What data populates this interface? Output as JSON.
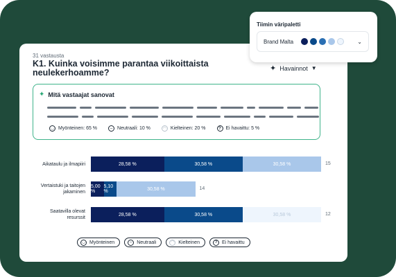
{
  "survey": {
    "response_count": "31 vastausta",
    "question": "K1. Kuinka voisimme parantaa viikoittaista neulekerhoamme?",
    "insights_button": "Havainnot"
  },
  "summary": {
    "title": "Mitä vastaajat sanovat",
    "sentiments": [
      {
        "label": "Myönteinen: 65 %",
        "icon": "smile-icon"
      },
      {
        "label": "Neutraali: 10 %",
        "icon": "neutral-face-icon"
      },
      {
        "label": "Kielteinen: 20 %",
        "icon": "frown-icon"
      },
      {
        "label": "Ei havaittu: 5 %",
        "icon": "question-icon"
      }
    ]
  },
  "chart_data": {
    "type": "bar",
    "orientation": "horizontal",
    "stacked": true,
    "categories": [
      "Aikataulu ja ilmapiiri",
      "Vertaistuki ja taitojen jakaminen",
      "Saatavilla olevat resurssit"
    ],
    "totals": [
      "15",
      "14",
      "12"
    ],
    "series": [
      {
        "name": "Myönteinen",
        "color": "#0b1f5c",
        "values": [
          28.58,
          5.0,
          28.58
        ],
        "labels": [
          "28,58 %",
          "5,00 %",
          "28,58 %"
        ]
      },
      {
        "name": "Neutraali",
        "color": "#0a4a8a",
        "values": [
          30.58,
          5.1,
          30.58
        ],
        "labels": [
          "30,58 %",
          "5,10 %",
          "30,58 %"
        ]
      },
      {
        "name": "Kielteinen",
        "color_per_row": [
          "#a9c7ea",
          "#a9c7ea",
          "#eef5fd"
        ],
        "values": [
          30.58,
          30.58,
          30.58
        ],
        "labels": [
          "30,58 %",
          "30,58 %",
          "30,58 %"
        ]
      }
    ],
    "legend_placement": "bottom"
  },
  "legend": [
    {
      "label": "Myönteinen",
      "icon": "smile-icon"
    },
    {
      "label": "Neutraali",
      "icon": "neutral-face-icon"
    },
    {
      "label": "Kielteinen",
      "icon": "frown-icon"
    },
    {
      "label": "Ei havaittu",
      "icon": "question-icon"
    }
  ],
  "palette": {
    "title": "Tiimin väripaletti",
    "selected": "Brand Malta",
    "swatch_colors": [
      "#0b1f5c",
      "#0a4a8a",
      "#2a6fb3",
      "#a9c7ea",
      "#eef5fd"
    ]
  }
}
